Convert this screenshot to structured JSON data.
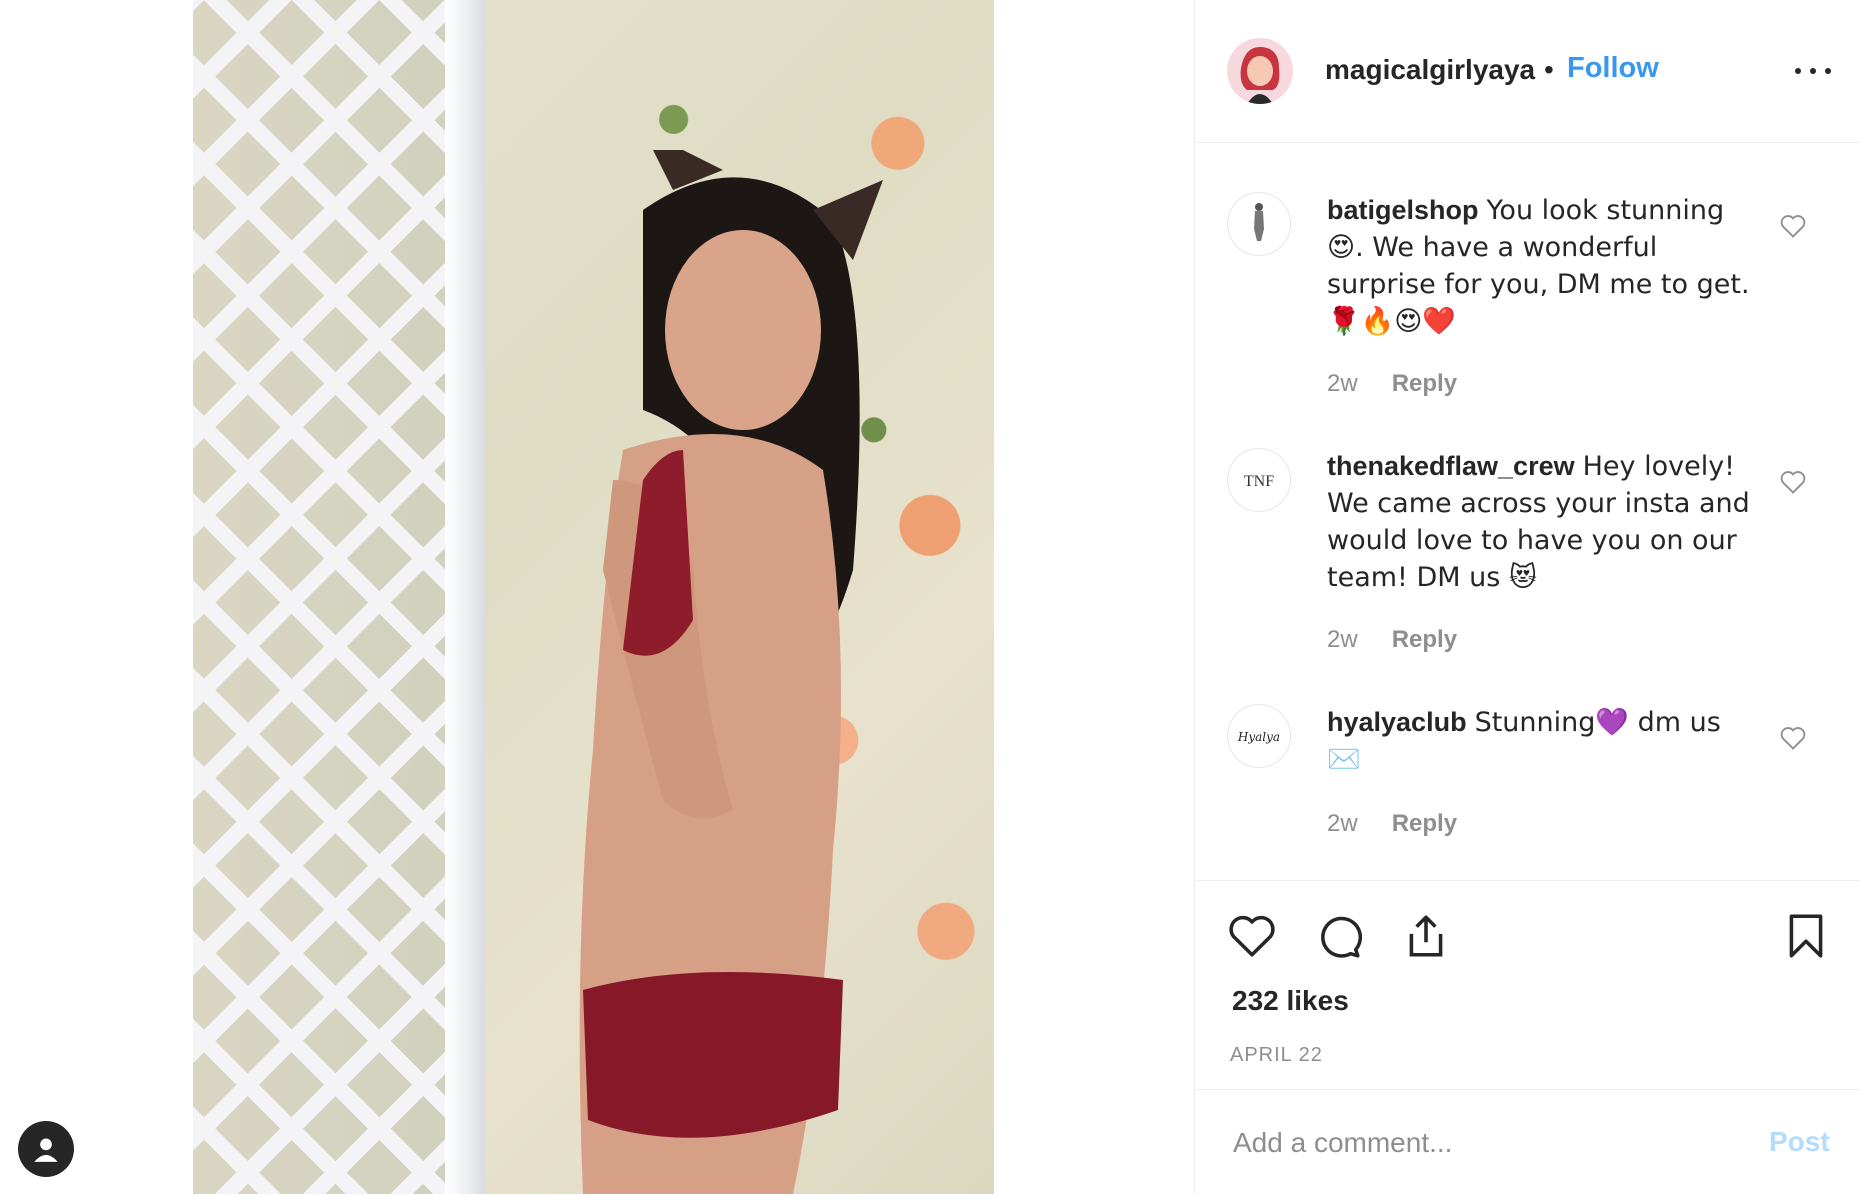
{
  "post": {
    "username": "magicalgirlyaya",
    "separator": "•",
    "follow_label": "Follow",
    "image_description_icon": "photo"
  },
  "comments": [
    {
      "username": "batigelshop",
      "text_line": "You look stunning 😍. We have a wonderful surprise for you, DM me to get. 🌹🔥😍❤️",
      "time": "2w",
      "reply_label": "Reply",
      "avatar_icon": "sketch-figure-icon"
    },
    {
      "username": "thenakedflaw_crew",
      "text_line": "Hey lovely! We came across your insta and would love to have you on our team! DM us 😻",
      "time": "2w",
      "reply_label": "Reply",
      "avatar_text": "TNF"
    },
    {
      "username": "hyalyaclub",
      "text_line": "Stunning💜 dm us ✉️",
      "time": "2w",
      "reply_label": "Reply",
      "avatar_text": "Hyalya"
    }
  ],
  "likes": "232 likes",
  "date": "APRIL 22",
  "add_comment": {
    "placeholder": "Add a comment...",
    "post_label": "Post"
  },
  "colors": {
    "link_blue": "#3897f0",
    "post_disabled": "#b3dbff",
    "text_primary": "#262626",
    "text_secondary": "#8e8e8e"
  }
}
